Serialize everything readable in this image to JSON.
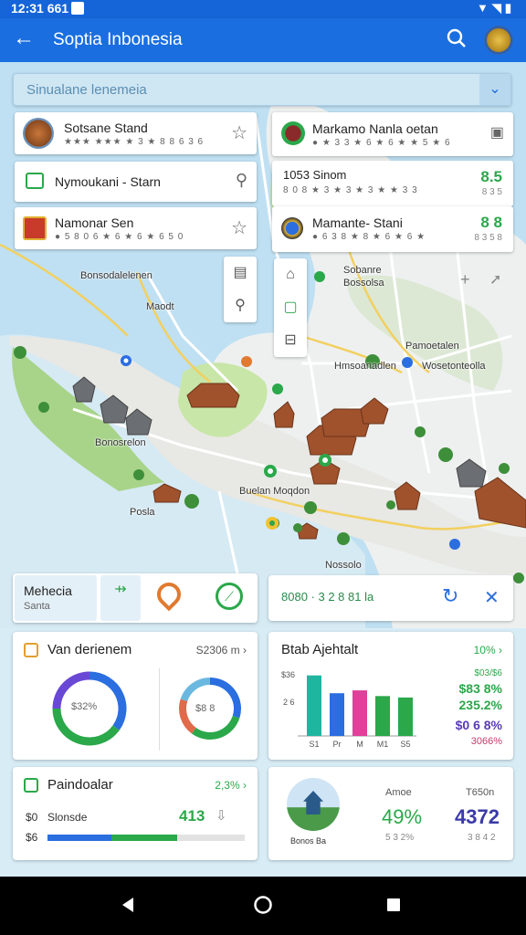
{
  "status": {
    "time": "12:31 661"
  },
  "appbar": {
    "title": "Soptia Inbonesia"
  },
  "search": {
    "query": "Sinualane lenemeia"
  },
  "places_left": [
    {
      "name": "Sotsane Stand",
      "sub": "★★★ ★★★ ★ 3 ★ 8 8 6 3 6"
    },
    {
      "name": "Nymoukani - Starn",
      "sub": ""
    },
    {
      "name": "Namonar Sen",
      "sub": "● 5 8 0 6 ★ 6 ★ 6 ★ 6 5 0"
    }
  ],
  "places_right": [
    {
      "name": "Markamo Nanla oetan",
      "sub": "● ★ 3 3 ★ 6 ★ 6 ★ ★ 5 ★ 6"
    },
    {
      "name": "1053 Sinom",
      "sub": "8 0 8 ★ 3 ★ 3 ★ 3 ★ ★ 3 3",
      "value": "8.5",
      "value_sub": "8 3 5"
    },
    {
      "name": "Mamante- Stani",
      "sub": "● 6 3 8 ★ 8 ★ 6 ★ 6 ★",
      "value": "8 8",
      "value_sub": "8 3 5 8"
    }
  ],
  "map_labels": [
    "Bonsodalelenen",
    "Maodt",
    "Sobanre",
    "Bossolsa",
    "Bonosrelon",
    "Posla",
    "Buelan Moqdon",
    "Hmsoanadlen",
    "Wosetonteolla",
    "Pamoetalen",
    "Nossolo"
  ],
  "bottom_tabs": {
    "left_title": "Mehecia",
    "left_sub": "Santa",
    "right_text": "8080 · 3 2 8 81 la"
  },
  "card1": {
    "title": "Van derienem",
    "link": "S2306 m",
    "donut1_label": "$32%",
    "donut2_label": "$8 8"
  },
  "card2": {
    "title": "Btab Ajehtalt",
    "link": "10%",
    "y1": "$36",
    "y2": "2 6",
    "x_labels": [
      "S1",
      "Pr",
      "M",
      "M1",
      "S5"
    ],
    "stats": [
      "$83 8%",
      "235.2%",
      "$0 6 8%",
      "3066%"
    ],
    "stats_head": "$03/$6"
  },
  "card3": {
    "title": "Paindoalar",
    "link": "2,3%",
    "row1": "Slonsde",
    "value": "413",
    "row1_label": "$0",
    "row2_label": "$6"
  },
  "card4": {
    "left_label": "Amoe",
    "left_value": "49%",
    "left_sub": "5 3 2%",
    "right_label": "T650n",
    "right_value": "4372",
    "right_sub": "3 8 4 2",
    "thumb_label": "Bonos Ba"
  },
  "chart_data": {
    "type": "bar",
    "categories": [
      "S1",
      "Pr",
      "M",
      "M1",
      "S5"
    ],
    "values": [
      85,
      60,
      64,
      56,
      54
    ],
    "colors": [
      "#1fb6a0",
      "#2a6ee0",
      "#e0409a",
      "#2aa84a",
      "#2aa84a"
    ],
    "ylim": [
      0,
      100
    ]
  },
  "donuts": [
    {
      "segments": [
        {
          "v": 35,
          "c": "#2a6ee0"
        },
        {
          "v": 40,
          "c": "#2aa84a"
        },
        {
          "v": 25,
          "c": "#6a48d6"
        }
      ]
    },
    {
      "segments": [
        {
          "v": 30,
          "c": "#2a6ee0"
        },
        {
          "v": 30,
          "c": "#2aa84a"
        },
        {
          "v": 20,
          "c": "#e06a4a"
        },
        {
          "v": 20,
          "c": "#6ab8e0"
        }
      ]
    }
  ],
  "colors": {
    "appbar": "#1a6ee0",
    "accent": "#2aa84a",
    "purple": "#5a3ab8"
  }
}
